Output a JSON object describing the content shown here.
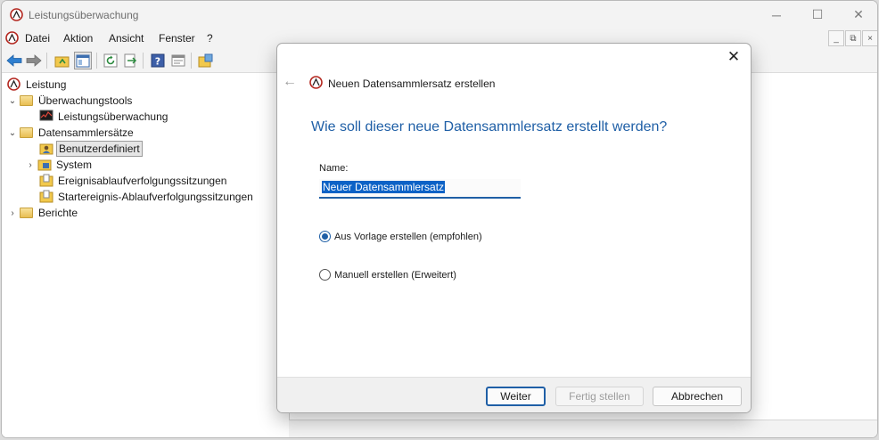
{
  "window": {
    "title": "Leistungsüberwachung",
    "controls": {
      "minimize": "─",
      "maximize": "☐",
      "close": "✕"
    }
  },
  "menubar": {
    "items": [
      "Datei",
      "Aktion",
      "Ansicht",
      "Fenster",
      "?"
    ],
    "mdi": {
      "minimize": "_",
      "restore": "⧉",
      "close": "×"
    }
  },
  "toolbar": {
    "buttons": [
      "back-arrow-icon",
      "forward-arrow-icon",
      "up-folder-icon",
      "show-hide-tree-icon",
      "refresh-icon",
      "export-list-icon",
      "help-icon",
      "properties-icon",
      "new-icon"
    ]
  },
  "tree": {
    "items": [
      {
        "label": "Leistung",
        "icon": "performance-icon"
      },
      {
        "label": "Überwachungstools",
        "icon": "folder-icon",
        "chevron": "⌄"
      },
      {
        "label": "Leistungsüberwachung",
        "icon": "monitor-chart-icon"
      },
      {
        "label": "Datensammlersätze",
        "icon": "folder-icon",
        "chevron": "⌄"
      },
      {
        "label": "Benutzerdefiniert",
        "icon": "user-folder-icon",
        "selected": true
      },
      {
        "label": "System",
        "icon": "system-folder-icon",
        "chevron": "›"
      },
      {
        "label": "Ereignisablaufverfolgungssitzungen",
        "icon": "trace-icon"
      },
      {
        "label": "Startereignis-Ablaufverfolgungssitzungen",
        "icon": "trace-icon"
      },
      {
        "label": "Berichte",
        "icon": "folder-icon",
        "chevron": "›"
      }
    ]
  },
  "dialog": {
    "close": "✕",
    "back": "←",
    "title": "Neuen Datensammlersatz erstellen",
    "question": "Wie soll dieser neue Datensammlersatz erstellt werden?",
    "name_label": "Name:",
    "name_value": "Neuer Datensammlersatz",
    "options": [
      {
        "label": "Aus Vorlage erstellen (empfohlen)",
        "checked": true
      },
      {
        "label": "Manuell erstellen (Erweitert)",
        "checked": false
      }
    ],
    "buttons": {
      "next": "Weiter",
      "finish": "Fertig stellen",
      "cancel": "Abbrechen"
    }
  },
  "colors": {
    "accent": "#1f5fa6",
    "selection": "#0c62c6",
    "chrome": "#f3f3f3"
  }
}
